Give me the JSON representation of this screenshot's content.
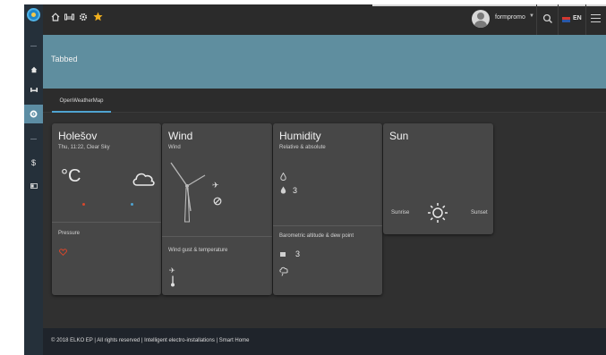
{
  "topbar": {
    "icons": [
      "home-icon",
      "sofa-icon",
      "gear-icon",
      "star-icon"
    ],
    "username": "formpromo",
    "language": "EN"
  },
  "sidebar": {
    "icons": [
      "more-icon",
      "home-icon",
      "sofa-icon",
      "gear-icon",
      "more-icon",
      "dollar-icon",
      "display-icon"
    ],
    "active_index": 3
  },
  "page": {
    "title": "Tabbed"
  },
  "tabs": [
    {
      "label": "OpenWeatherMap",
      "active": true
    }
  ],
  "cards": {
    "location": {
      "title": "Holešov",
      "subtitle": "Thu, 11:22, Clear Sky",
      "temperature_unit": "°C",
      "weather_icon": "cloud-icon",
      "pressure_label": "Pressure",
      "pressure_icon": "heart-outline-icon"
    },
    "wind": {
      "title": "Wind",
      "subtitle": "Wind",
      "gust_label": "Wind gust & temperature"
    },
    "humidity": {
      "title": "Humidity",
      "subtitle": "Relative & absolute",
      "absolute_value": "3",
      "barometric_label": "Barometric altitude & dew point",
      "altitude_value": "3"
    },
    "sun": {
      "title": "Sun",
      "sunrise_label": "Sunrise",
      "sunset_label": "Sunset"
    }
  },
  "footer": {
    "text": "© 2018 ELKO EP | All rights reserved | Intelligent electro-installations | Smart Home"
  },
  "colors": {
    "header_bg": "#5f8e9f",
    "tab_underline": "#4fa3d1",
    "sidebar_bg": "#25303a",
    "card_bg": "#474747",
    "accent_red": "#d9472b",
    "accent_blue": "#4fa3d1",
    "favorite_star": "#f2b01e"
  }
}
